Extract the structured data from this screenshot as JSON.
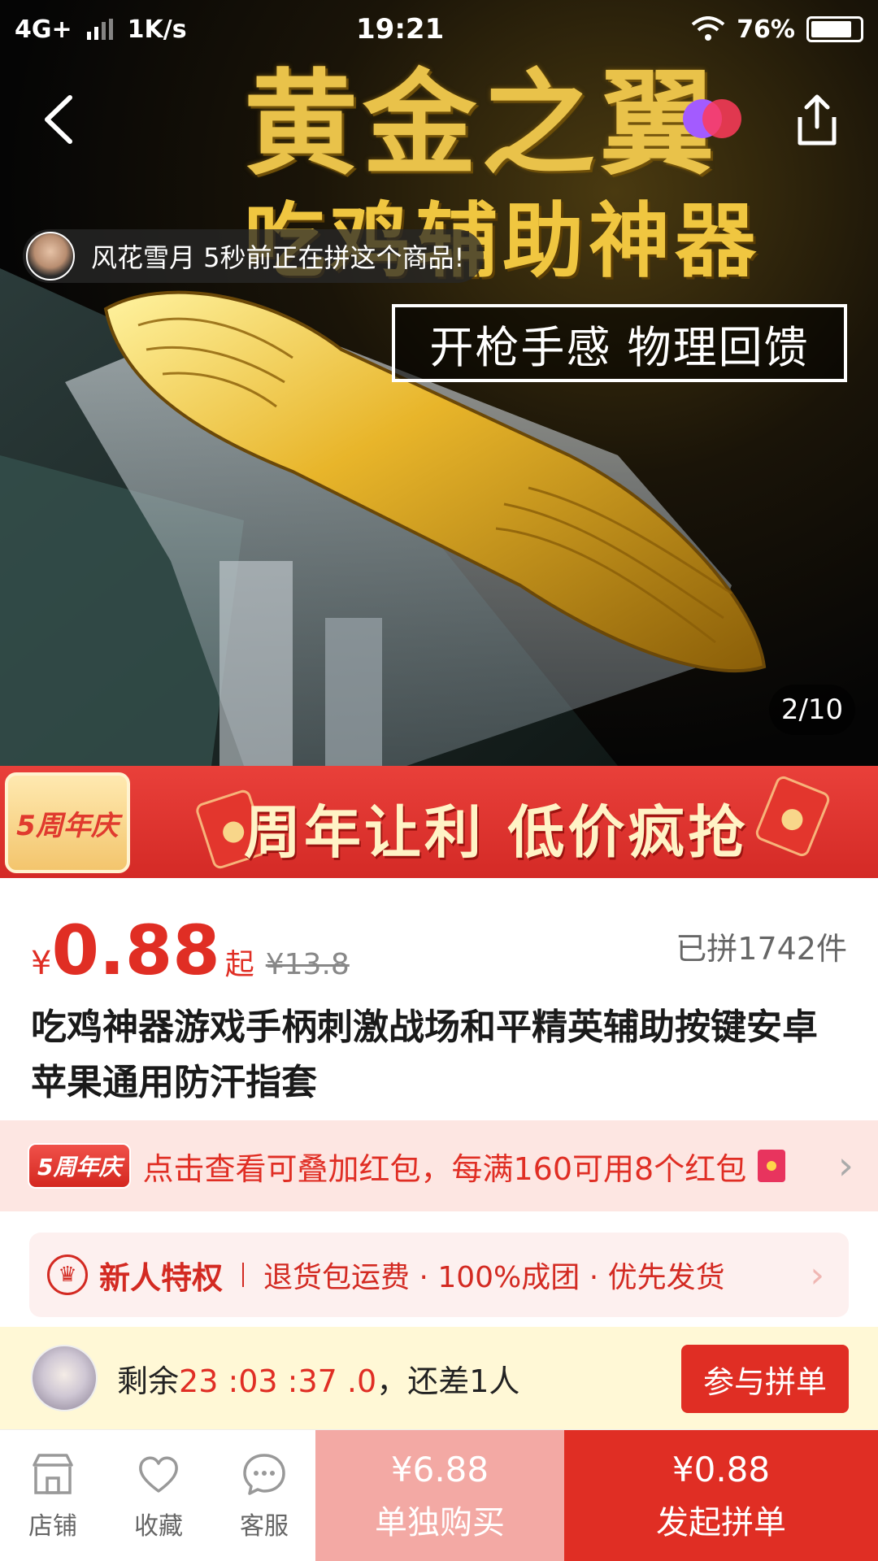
{
  "status_bar": {
    "network": "4G+",
    "speed": "1K/s",
    "time": "19:21",
    "battery": "76%"
  },
  "hero": {
    "title": "黄金之翼",
    "subtitle": "吃鸡辅助神器",
    "tagline": "开枪手感 物理回馈",
    "ticker_text": "风花雪月 5秒前正在拼这个商品!",
    "page_indicator": "2/10"
  },
  "promo_banner": {
    "badge": "5周年庆",
    "text": "周年让利 低价疯抢"
  },
  "price": {
    "currency": "¥",
    "value": "0.88",
    "suffix": "起",
    "original": "¥13.8",
    "sold": "已拼1742件"
  },
  "product": {
    "title": "吃鸡神器游戏手柄刺激战场和平精英辅助按键安卓苹果通用防汗指套"
  },
  "coupon": {
    "tag": "5周年庆",
    "text": "点击查看可叠加红包，每满160可用8个红包"
  },
  "privilege": {
    "title": "新人特权",
    "description": "退货包运费 · 100%成团 · 优先发货"
  },
  "group": {
    "prefix": "剩余",
    "timer": "23 :03 :37 .0",
    "suffix": "，还差1人",
    "join_label": "参与拼单"
  },
  "bottom_bar": {
    "shop": "店铺",
    "favorite": "收藏",
    "service": "客服",
    "buy_alone_price": "¥6.88",
    "buy_alone_label": "单独购买",
    "group_price": "¥0.88",
    "group_label": "发起拼单"
  },
  "colors": {
    "accent": "#e02e24",
    "gold": "#e9c24a",
    "coupon_bg": "#fde6e2",
    "group_bg": "#fff8d6"
  }
}
